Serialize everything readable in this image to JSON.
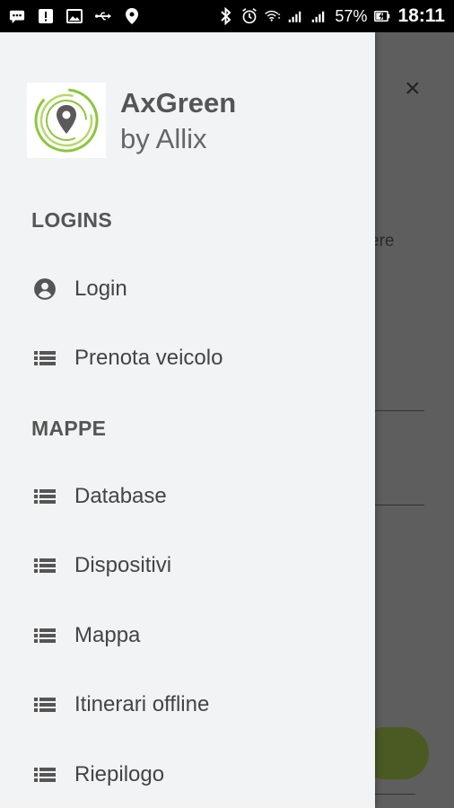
{
  "status_bar": {
    "battery": "57%",
    "time": "18:11",
    "icons": [
      "chat-icon",
      "alert-icon",
      "image-icon",
      "usb-icon",
      "location-icon",
      "bluetooth-icon",
      "alarm-icon",
      "wifi-icon",
      "signal-icon",
      "signal-icon",
      "battery-charging-icon"
    ]
  },
  "background_app": {
    "close_glyph": "×",
    "partial_text": "ere"
  },
  "drawer": {
    "brand": {
      "name": "AxGreen",
      "subtitle": "by Allix",
      "logo_colors": [
        "#8dc63f",
        "#b5d86b",
        "#5a5a5a"
      ]
    },
    "sections": [
      {
        "title": "LOGINS",
        "items": [
          {
            "label": "Login",
            "icon": "account-circle-icon"
          },
          {
            "label": "Prenota veicolo",
            "icon": "list-icon"
          }
        ]
      },
      {
        "title": "MAPPE",
        "items": [
          {
            "label": "Database",
            "icon": "list-icon"
          },
          {
            "label": "Dispositivi",
            "icon": "list-icon"
          },
          {
            "label": "Mappa",
            "icon": "list-icon"
          },
          {
            "label": "Itinerari offline",
            "icon": "list-icon"
          },
          {
            "label": "Riepilogo",
            "icon": "list-icon"
          }
        ]
      }
    ]
  },
  "colors": {
    "drawer_bg": "#f2f3f5",
    "scrim": "#5e5e5e",
    "text": "#444444",
    "accent_green": "#8dc63f"
  }
}
